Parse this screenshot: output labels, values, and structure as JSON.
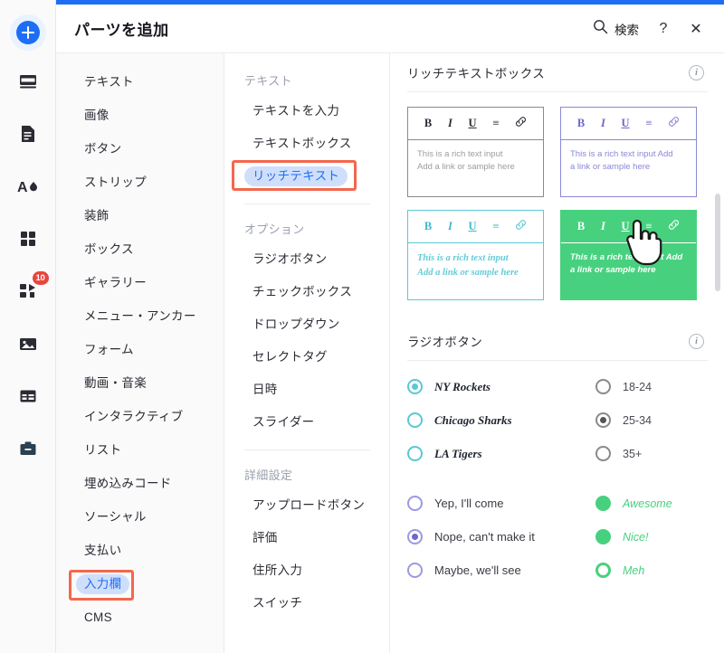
{
  "theme": {
    "accent": "#1d6ef5",
    "highlight_box": "#f4674c",
    "pill_bg": "#cfdffb",
    "badge": "#e8453c"
  },
  "rail": {
    "items": [
      {
        "name": "add-button",
        "icon": "plus-circle-icon",
        "label": ""
      },
      {
        "name": "rail-item-layout",
        "icon": "layout-icon",
        "label": ""
      },
      {
        "name": "rail-item-pages",
        "icon": "page-icon",
        "label": ""
      },
      {
        "name": "rail-item-theme",
        "icon": "font-droplet-icon",
        "label": ""
      },
      {
        "name": "rail-item-apps",
        "icon": "grid-icon",
        "label": ""
      },
      {
        "name": "rail-item-addons",
        "icon": "puzzle-icon",
        "label": "",
        "badge": "10"
      },
      {
        "name": "rail-item-media",
        "icon": "image-icon",
        "label": ""
      },
      {
        "name": "rail-item-blog",
        "icon": "table-icon",
        "label": ""
      },
      {
        "name": "rail-item-business",
        "icon": "briefcase-icon",
        "label": ""
      }
    ]
  },
  "header": {
    "title": "パーツを追加",
    "search_label": "検索",
    "search_icon": "search-icon",
    "help_label": "?",
    "close_label": "✕"
  },
  "categories": [
    {
      "label": "テキスト",
      "selected": false
    },
    {
      "label": "画像",
      "selected": false
    },
    {
      "label": "ボタン",
      "selected": false
    },
    {
      "label": "ストリップ",
      "selected": false
    },
    {
      "label": "装飾",
      "selected": false
    },
    {
      "label": "ボックス",
      "selected": false
    },
    {
      "label": "ギャラリー",
      "selected": false
    },
    {
      "label": "メニュー・アンカー",
      "selected": false
    },
    {
      "label": "フォーム",
      "selected": false
    },
    {
      "label": "動画・音楽",
      "selected": false
    },
    {
      "label": "インタラクティブ",
      "selected": false
    },
    {
      "label": "リスト",
      "selected": false
    },
    {
      "label": "埋め込みコード",
      "selected": false
    },
    {
      "label": "ソーシャル",
      "selected": false
    },
    {
      "label": "支払い",
      "selected": false
    },
    {
      "label": "入力欄",
      "selected": true
    },
    {
      "label": "CMS",
      "selected": false
    }
  ],
  "subgroups": [
    {
      "title": "テキスト",
      "items": [
        {
          "label": "テキストを入力",
          "selected": false
        },
        {
          "label": "テキストボックス",
          "selected": false
        },
        {
          "label": "リッチテキスト",
          "selected": true
        }
      ]
    },
    {
      "title": "オプション",
      "items": [
        {
          "label": "ラジオボタン",
          "selected": false
        },
        {
          "label": "チェックボックス",
          "selected": false
        },
        {
          "label": "ドロップダウン",
          "selected": false
        },
        {
          "label": "セレクトタグ",
          "selected": false
        },
        {
          "label": "日時",
          "selected": false
        },
        {
          "label": "スライダー",
          "selected": false
        }
      ]
    },
    {
      "title": "詳細設定",
      "items": [
        {
          "label": "アップロードボタン",
          "selected": false
        },
        {
          "label": "評価",
          "selected": false
        },
        {
          "label": "住所入力",
          "selected": false
        },
        {
          "label": "スイッチ",
          "selected": false
        }
      ]
    }
  ],
  "preview": {
    "sections": [
      {
        "title": "リッチテキストボックス",
        "info_icon": "info-icon"
      },
      {
        "title": "ラジオボタン",
        "info_icon": "info-icon"
      }
    ],
    "rich_text_boxes": [
      {
        "variant": "gray",
        "toolbar": [
          "B",
          "I",
          "U",
          "≡",
          "🔗"
        ],
        "line1": "This is a rich text input",
        "line2": "Add a link or sample here"
      },
      {
        "variant": "purple",
        "toolbar": [
          "B",
          "I",
          "U",
          "≡",
          "🔗"
        ],
        "line1": "This is a rich text input Add",
        "line2": "a link or sample here"
      },
      {
        "variant": "teal",
        "toolbar": [
          "B",
          "I",
          "U",
          "≡",
          "🔗"
        ],
        "line1": "This is a rich text input",
        "line2": "Add a link or sample here"
      },
      {
        "variant": "green",
        "toolbar": [
          "B",
          "I",
          "U",
          "≡",
          "🔗"
        ],
        "line1": "This is a rich text input Add",
        "line2": "a link or sample here"
      }
    ],
    "radio_sets": {
      "teams": [
        {
          "label": "NY Rockets",
          "checked": true
        },
        {
          "label": "Chicago Sharks",
          "checked": false
        },
        {
          "label": "LA Tigers",
          "checked": false
        }
      ],
      "ages": [
        {
          "label": "18-24",
          "checked": false
        },
        {
          "label": "25-34",
          "checked": true
        },
        {
          "label": "35+",
          "checked": false
        }
      ],
      "rsvp": [
        {
          "label": "Yep, I'll come",
          "checked": false
        },
        {
          "label": "Nope, can't make it",
          "checked": true
        },
        {
          "label": "Maybe, we'll see",
          "checked": false
        }
      ],
      "ratings": [
        {
          "label": "Awesome",
          "checked": true
        },
        {
          "label": "Nice!",
          "checked": true
        },
        {
          "label": "Meh",
          "checked": false
        }
      ]
    }
  }
}
